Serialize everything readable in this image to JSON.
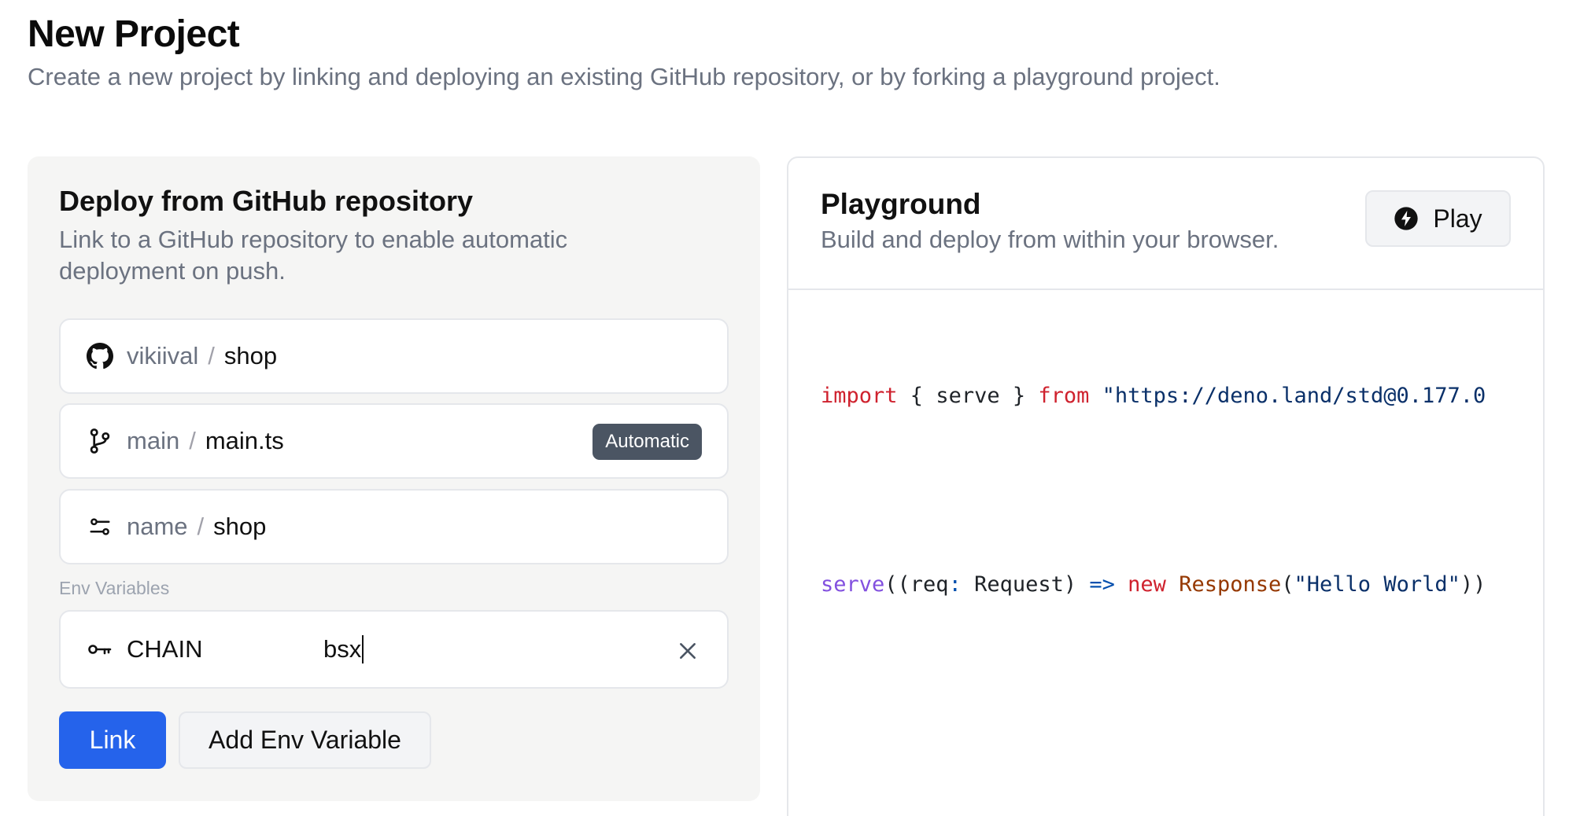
{
  "header": {
    "title": "New Project",
    "subtitle": "Create a new project by linking and deploying an existing GitHub repository, or by forking a playground project."
  },
  "github_card": {
    "title": "Deploy from GitHub repository",
    "description": "Link to a GitHub repository to enable automatic deployment on push.",
    "repo": {
      "owner": "vikiival",
      "separator": "/",
      "name": "shop",
      "icon": "github-icon"
    },
    "entry": {
      "branch": "main",
      "separator": "/",
      "file": "main.ts",
      "badge": "Automatic",
      "icon": "git-branch-icon"
    },
    "project": {
      "label": "name",
      "separator": "/",
      "value": "shop",
      "icon": "sliders-icon"
    },
    "env_label": "Env Variables",
    "env": {
      "key": "CHAIN",
      "value": "bsx",
      "icon": "key-icon"
    },
    "link_button": "Link",
    "add_env_button": "Add Env Variable"
  },
  "playground_card": {
    "title": "Playground",
    "description": "Build and deploy from within your browser.",
    "play_button": "Play",
    "code": {
      "line1": {
        "kw_import": "import",
        "brace_open": " { serve } ",
        "kw_from": "from",
        "space": " ",
        "url": "\"https://deno.land/std@0.177.0"
      },
      "line2": {
        "fn": "serve",
        "p1": "((req",
        "colon": ":",
        "type": " Request) ",
        "arrow": "=>",
        "space": " ",
        "kw_new": "new",
        "space2": " ",
        "cls": "Response",
        "p2": "(",
        "str": "\"Hello World\"",
        "p3": "))"
      }
    }
  },
  "colors": {
    "accent": "#2563eb",
    "badge_bg": "#4b5563",
    "card_bg": "#f5f5f4",
    "muted_text": "#6b7280",
    "keyword": "#cf222e",
    "string": "#0a3069"
  }
}
